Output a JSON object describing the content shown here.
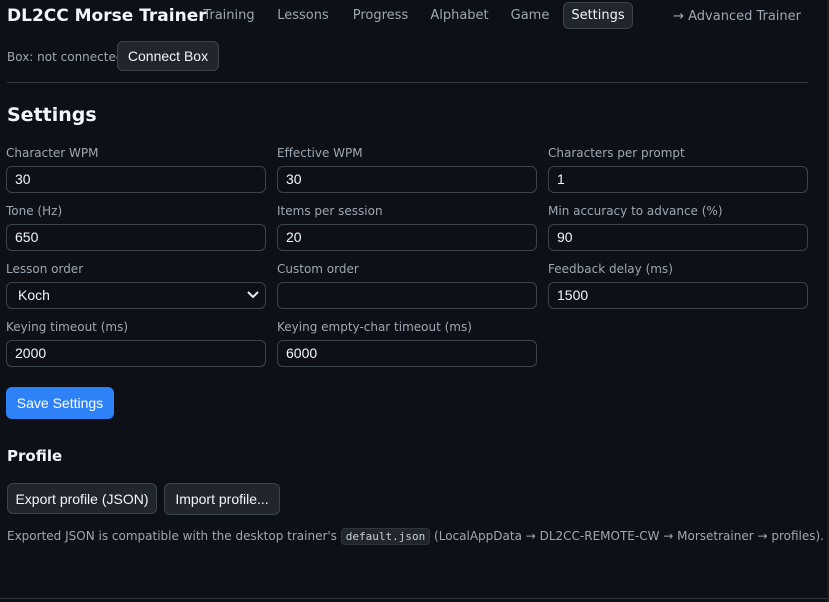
{
  "app": {
    "title": "DL2CC Morse Trainer"
  },
  "nav": {
    "tabs": [
      {
        "label": "Training"
      },
      {
        "label": "Lessons"
      },
      {
        "label": "Progress"
      },
      {
        "label": "Alphabet"
      },
      {
        "label": "Game"
      },
      {
        "label": "Settings",
        "active": true
      }
    ],
    "advanced_link": "→ Advanced Trainer"
  },
  "status": {
    "box_status": "Box: not connected",
    "connect_label": "Connect Box"
  },
  "settings": {
    "title": "Settings",
    "fields": {
      "char_wpm": {
        "label": "Character WPM",
        "value": "30"
      },
      "eff_wpm": {
        "label": "Effective WPM",
        "value": "30"
      },
      "chars_per_prompt": {
        "label": "Characters per prompt",
        "value": "1"
      },
      "tone": {
        "label": "Tone (Hz)",
        "value": "650"
      },
      "items_per_session": {
        "label": "Items per session",
        "value": "20"
      },
      "min_accuracy": {
        "label": "Min accuracy to advance (%)",
        "value": "90"
      },
      "lesson_order": {
        "label": "Lesson order",
        "value": "Koch"
      },
      "custom_order": {
        "label": "Custom order",
        "value": ""
      },
      "feedback_delay": {
        "label": "Feedback delay (ms)",
        "value": "1500"
      },
      "keying_timeout": {
        "label": "Keying timeout (ms)",
        "value": "2000"
      },
      "keying_empty_timeout": {
        "label": "Keying empty-char timeout (ms)",
        "value": "6000"
      }
    },
    "save_label": "Save Settings"
  },
  "profile": {
    "title": "Profile",
    "export_label": "Export profile (JSON)",
    "import_label": "Import profile...",
    "note_before": "Exported JSON is compatible with the desktop trainer's ",
    "note_code": "default.json",
    "note_after": " (LocalAppData → DL2CC-REMOTE-CW → Morsetrainer → profiles)."
  }
}
